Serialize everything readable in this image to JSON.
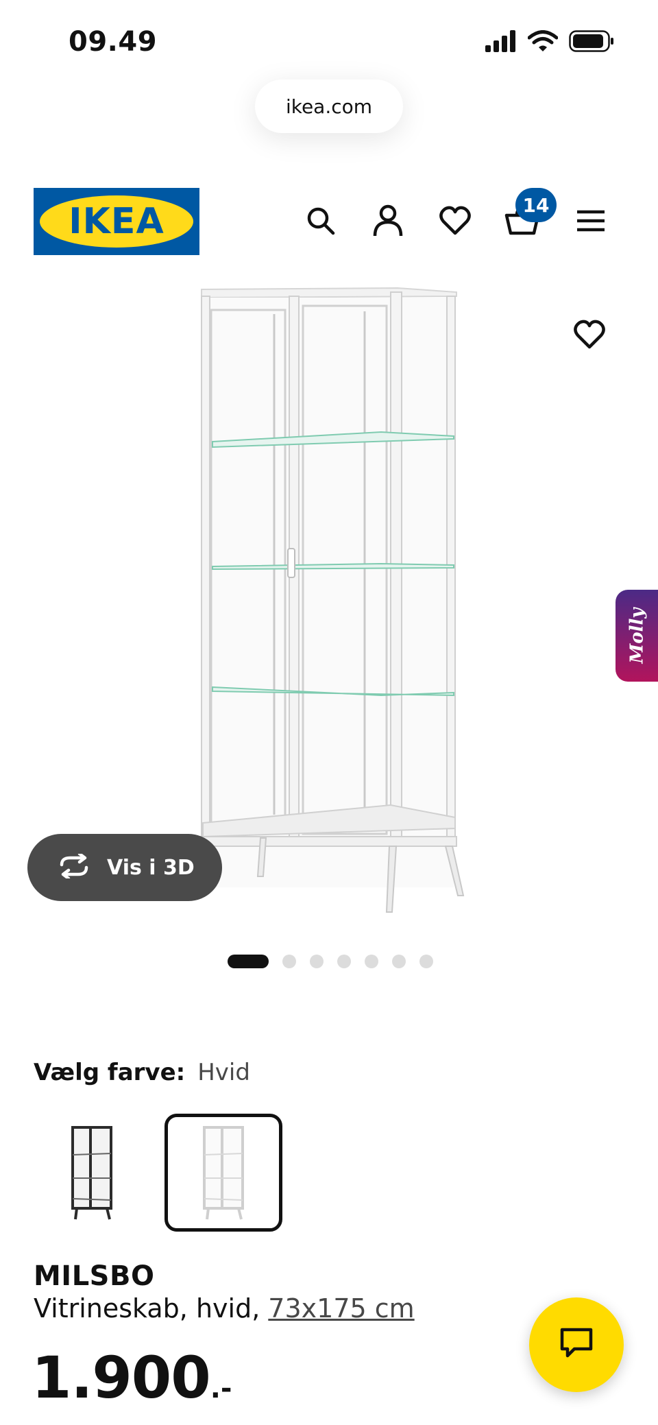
{
  "status_bar": {
    "time": "09.49",
    "signal_icon": "cellular-signal-icon",
    "wifi_icon": "wifi-icon",
    "battery_icon": "battery-icon"
  },
  "browser": {
    "url": "ikea.com"
  },
  "header": {
    "logo_text": "IKEA",
    "brand_colors": {
      "blue": "#0058a3",
      "yellow": "#ffda1a"
    },
    "icons": [
      "search-icon",
      "account-icon",
      "heart-icon",
      "cart-icon",
      "menu-icon"
    ],
    "cart_count": "14"
  },
  "gallery": {
    "view_3d_label": "Vis i 3D",
    "image_count": 7,
    "active_index": 0,
    "side_tab_label": "Molly"
  },
  "color_picker": {
    "label": "Vælg farve:",
    "selected": "Hvid",
    "options": [
      {
        "color": "black-brown",
        "frame": "#2b2b2b",
        "selected": false
      },
      {
        "color": "white",
        "frame": "#d9d9d9",
        "selected": true
      }
    ]
  },
  "product": {
    "name": "MILSBO",
    "description": "Vitrineskab, hvid,",
    "size": "73x175 cm",
    "price": "1.900",
    "price_suffix": ".-"
  },
  "chat": {
    "icon": "chat-bubble-icon",
    "color": "#ffdb00"
  }
}
